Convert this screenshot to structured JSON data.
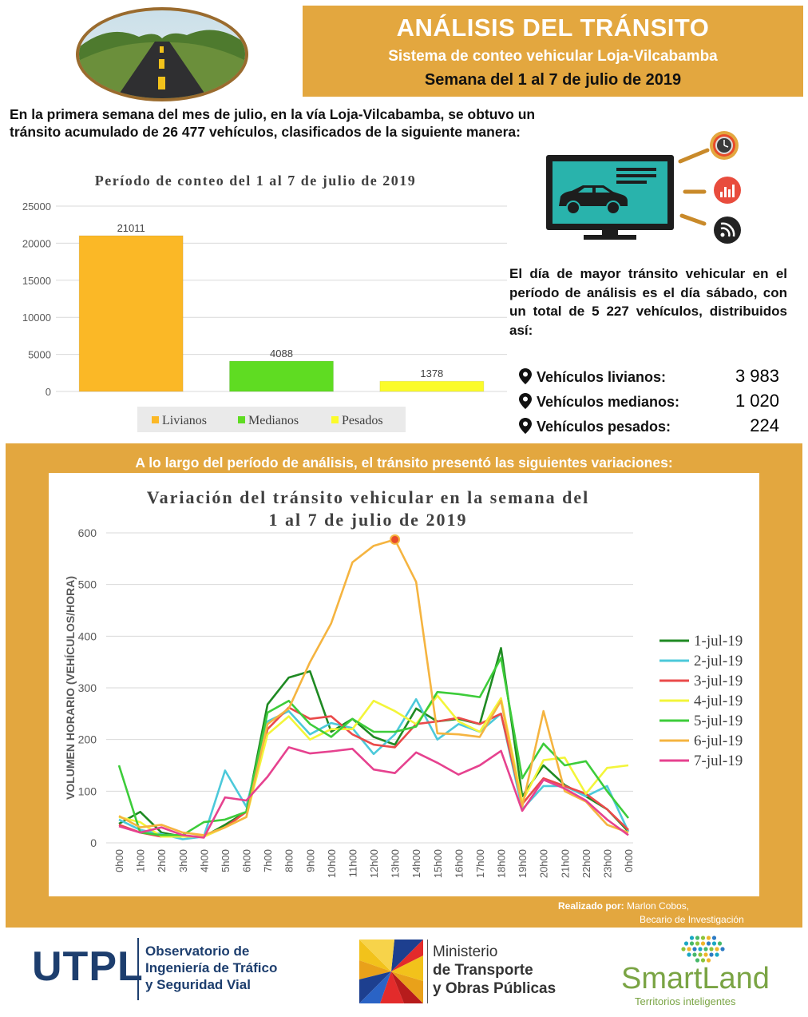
{
  "header": {
    "title": "ANÁLISIS DEL TRÁNSITO",
    "subtitle": "Sistema de conteo vehicular Loja-Vilcabamba",
    "week": "Semana del 1 al 7 de julio de 2019"
  },
  "intro_text": "En la primera semana del mes de julio, en la vía Loja-Vilcabamba, se obtuvo un tránsito acumulado de 26 477 vehículos, clasificados de la siguiente manera:",
  "side_text": "El día de mayor tránsito vehicular en el período de análisis es el día sábado, con un total de 5 227 vehículos, distribuidos así:",
  "stats": [
    {
      "label": "Vehículos livianos:",
      "value": "3 983"
    },
    {
      "label": "Vehículos medianos:",
      "value": "1 020"
    },
    {
      "label": "Vehículos pesados:",
      "value": "224"
    }
  ],
  "section_heading": "A lo largo del período de análisis, el tránsito presentó las siguientes variaciones:",
  "credits": {
    "prefix": "Realizado por:",
    "name": "Marlon Cobos,",
    "role": "Becario de Investigación"
  },
  "footer": {
    "utpl": "UTPL",
    "observatorio": [
      "Observatorio de",
      "Ingeniería de Tráfico",
      "y Seguridad Vial"
    ],
    "ministerio": [
      "Ministerio",
      "de Transporte",
      "y Obras Públicas"
    ],
    "smartland": "SmartLand",
    "smartland_sub": "Territorios inteligentes"
  },
  "colors": {
    "accent": "#e3a73f",
    "navy": "#1d3e6e",
    "green_brand": "#7aa444"
  },
  "chart_data": [
    {
      "type": "bar",
      "title": "Período de conteo del 1 al 7 de julio de 2019",
      "categories": [
        "Livianos",
        "Medianos",
        "Pesados"
      ],
      "values": [
        21011,
        4088,
        1378
      ],
      "colors": [
        "#fbb826",
        "#5fdc22",
        "#fbfb2a"
      ],
      "ylim": [
        0,
        25000
      ],
      "yticks": [
        0,
        5000,
        10000,
        15000,
        20000,
        25000
      ],
      "legend": "bottom",
      "grid": true
    },
    {
      "type": "line",
      "title": "Variación del tránsito vehicular en la semana del 1 al 7 de julio de 2019",
      "ylabel": "VOLUMEN HORARIO (VEHÍCULOS/HORA)",
      "x": [
        "0h00",
        "1h00",
        "2h00",
        "3h00",
        "4h00",
        "5h00",
        "6h00",
        "7h00",
        "8h00",
        "9h00",
        "10h00",
        "11h00",
        "12h00",
        "13h00",
        "14h00",
        "15h00",
        "16h00",
        "17h00",
        "18h00",
        "19h00",
        "20h00",
        "21h00",
        "22h00",
        "23h00",
        "0h00"
      ],
      "ylim": [
        0,
        600
      ],
      "yticks": [
        0,
        100,
        200,
        300,
        400,
        500,
        600
      ],
      "legend": "right",
      "grid": true,
      "highlight": {
        "series": "6-jul-19",
        "x": "13h00",
        "y": 587
      },
      "series": [
        {
          "name": "1-jul-19",
          "color": "#1f8a23",
          "values": [
            37,
            60,
            20,
            12,
            12,
            35,
            60,
            268,
            320,
            332,
            215,
            240,
            205,
            190,
            260,
            235,
            240,
            230,
            377,
            90,
            150,
            112,
            90,
            65,
            22
          ]
        },
        {
          "name": "2-jul-19",
          "color": "#4cc9da",
          "values": [
            45,
            25,
            17,
            7,
            12,
            140,
            70,
            235,
            255,
            210,
            232,
            222,
            172,
            210,
            278,
            200,
            230,
            215,
            250,
            65,
            110,
            110,
            90,
            110,
            22
          ]
        },
        {
          "name": "3-jul-19",
          "color": "#ea4a4a",
          "values": [
            35,
            20,
            12,
            12,
            12,
            30,
            60,
            220,
            262,
            240,
            245,
            210,
            190,
            185,
            230,
            235,
            242,
            230,
            250,
            75,
            125,
            110,
            95,
            65,
            25
          ]
        },
        {
          "name": "4-jul-19",
          "color": "#f3f53a",
          "values": [
            50,
            40,
            12,
            12,
            12,
            30,
            50,
            210,
            245,
            200,
            220,
            220,
            275,
            255,
            230,
            285,
            235,
            215,
            280,
            80,
            160,
            165,
            95,
            145,
            150
          ]
        },
        {
          "name": "5-jul-19",
          "color": "#3dcc3a",
          "values": [
            150,
            20,
            15,
            15,
            40,
            45,
            60,
            252,
            275,
            230,
            205,
            240,
            215,
            215,
            225,
            292,
            288,
            282,
            358,
            125,
            192,
            150,
            158,
            100,
            48
          ]
        },
        {
          "name": "6-jul-19",
          "color": "#f5b440",
          "values": [
            52,
            30,
            35,
            20,
            15,
            30,
            50,
            230,
            260,
            350,
            425,
            543,
            575,
            587,
            505,
            212,
            210,
            205,
            275,
            70,
            255,
            100,
            80,
            35,
            20
          ]
        },
        {
          "name": "7-jul-19",
          "color": "#e6428f",
          "values": [
            32,
            20,
            30,
            15,
            10,
            88,
            82,
            128,
            185,
            173,
            177,
            182,
            142,
            135,
            175,
            155,
            132,
            150,
            178,
            62,
            122,
            105,
            82,
            45,
            15
          ]
        }
      ]
    }
  ]
}
